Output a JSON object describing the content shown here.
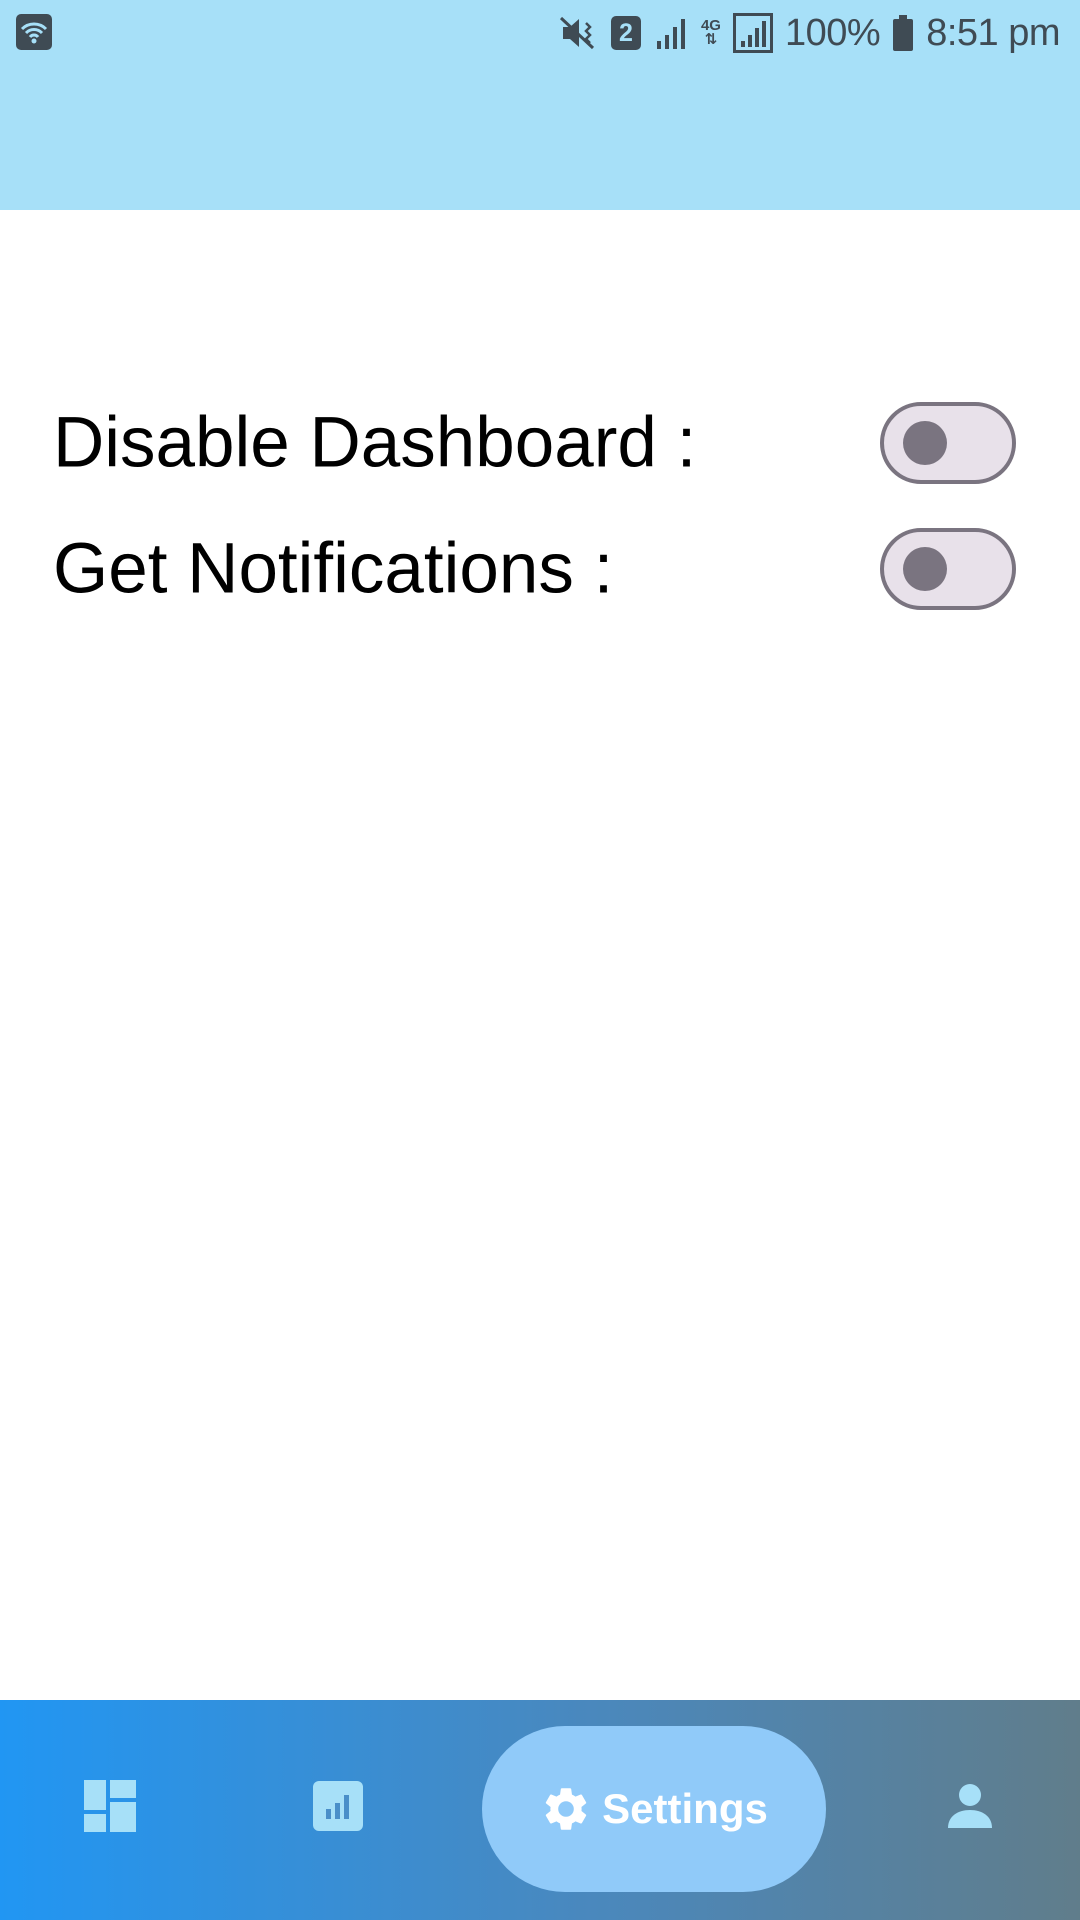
{
  "status_bar": {
    "battery_percent": "100%",
    "time": "8:51 pm",
    "sim_slot": "2",
    "network_type": "4G",
    "icons": [
      "wifi-icon",
      "mute-vibrate-icon",
      "sim-2-icon",
      "signal-icon",
      "4g-icon",
      "signal-icon",
      "battery-icon"
    ]
  },
  "settings": {
    "items": [
      {
        "label": "Disable Dashboard :",
        "enabled": false
      },
      {
        "label": "Get Notifications :",
        "enabled": false
      }
    ]
  },
  "bottom_nav": {
    "items": [
      {
        "icon": "dashboard-icon",
        "active": false
      },
      {
        "icon": "stats-icon",
        "active": false
      },
      {
        "icon": "gear-icon",
        "label": "Settings",
        "active": true
      },
      {
        "icon": "person-icon",
        "active": false
      }
    ]
  },
  "colors": {
    "header_bg": "#a7e0f8",
    "nav_gradient_start": "#2196f3",
    "nav_gradient_end": "#607d8b",
    "active_pill": "#90caf9",
    "toggle_track": "#e8e1ea",
    "toggle_border": "#7a7480"
  }
}
